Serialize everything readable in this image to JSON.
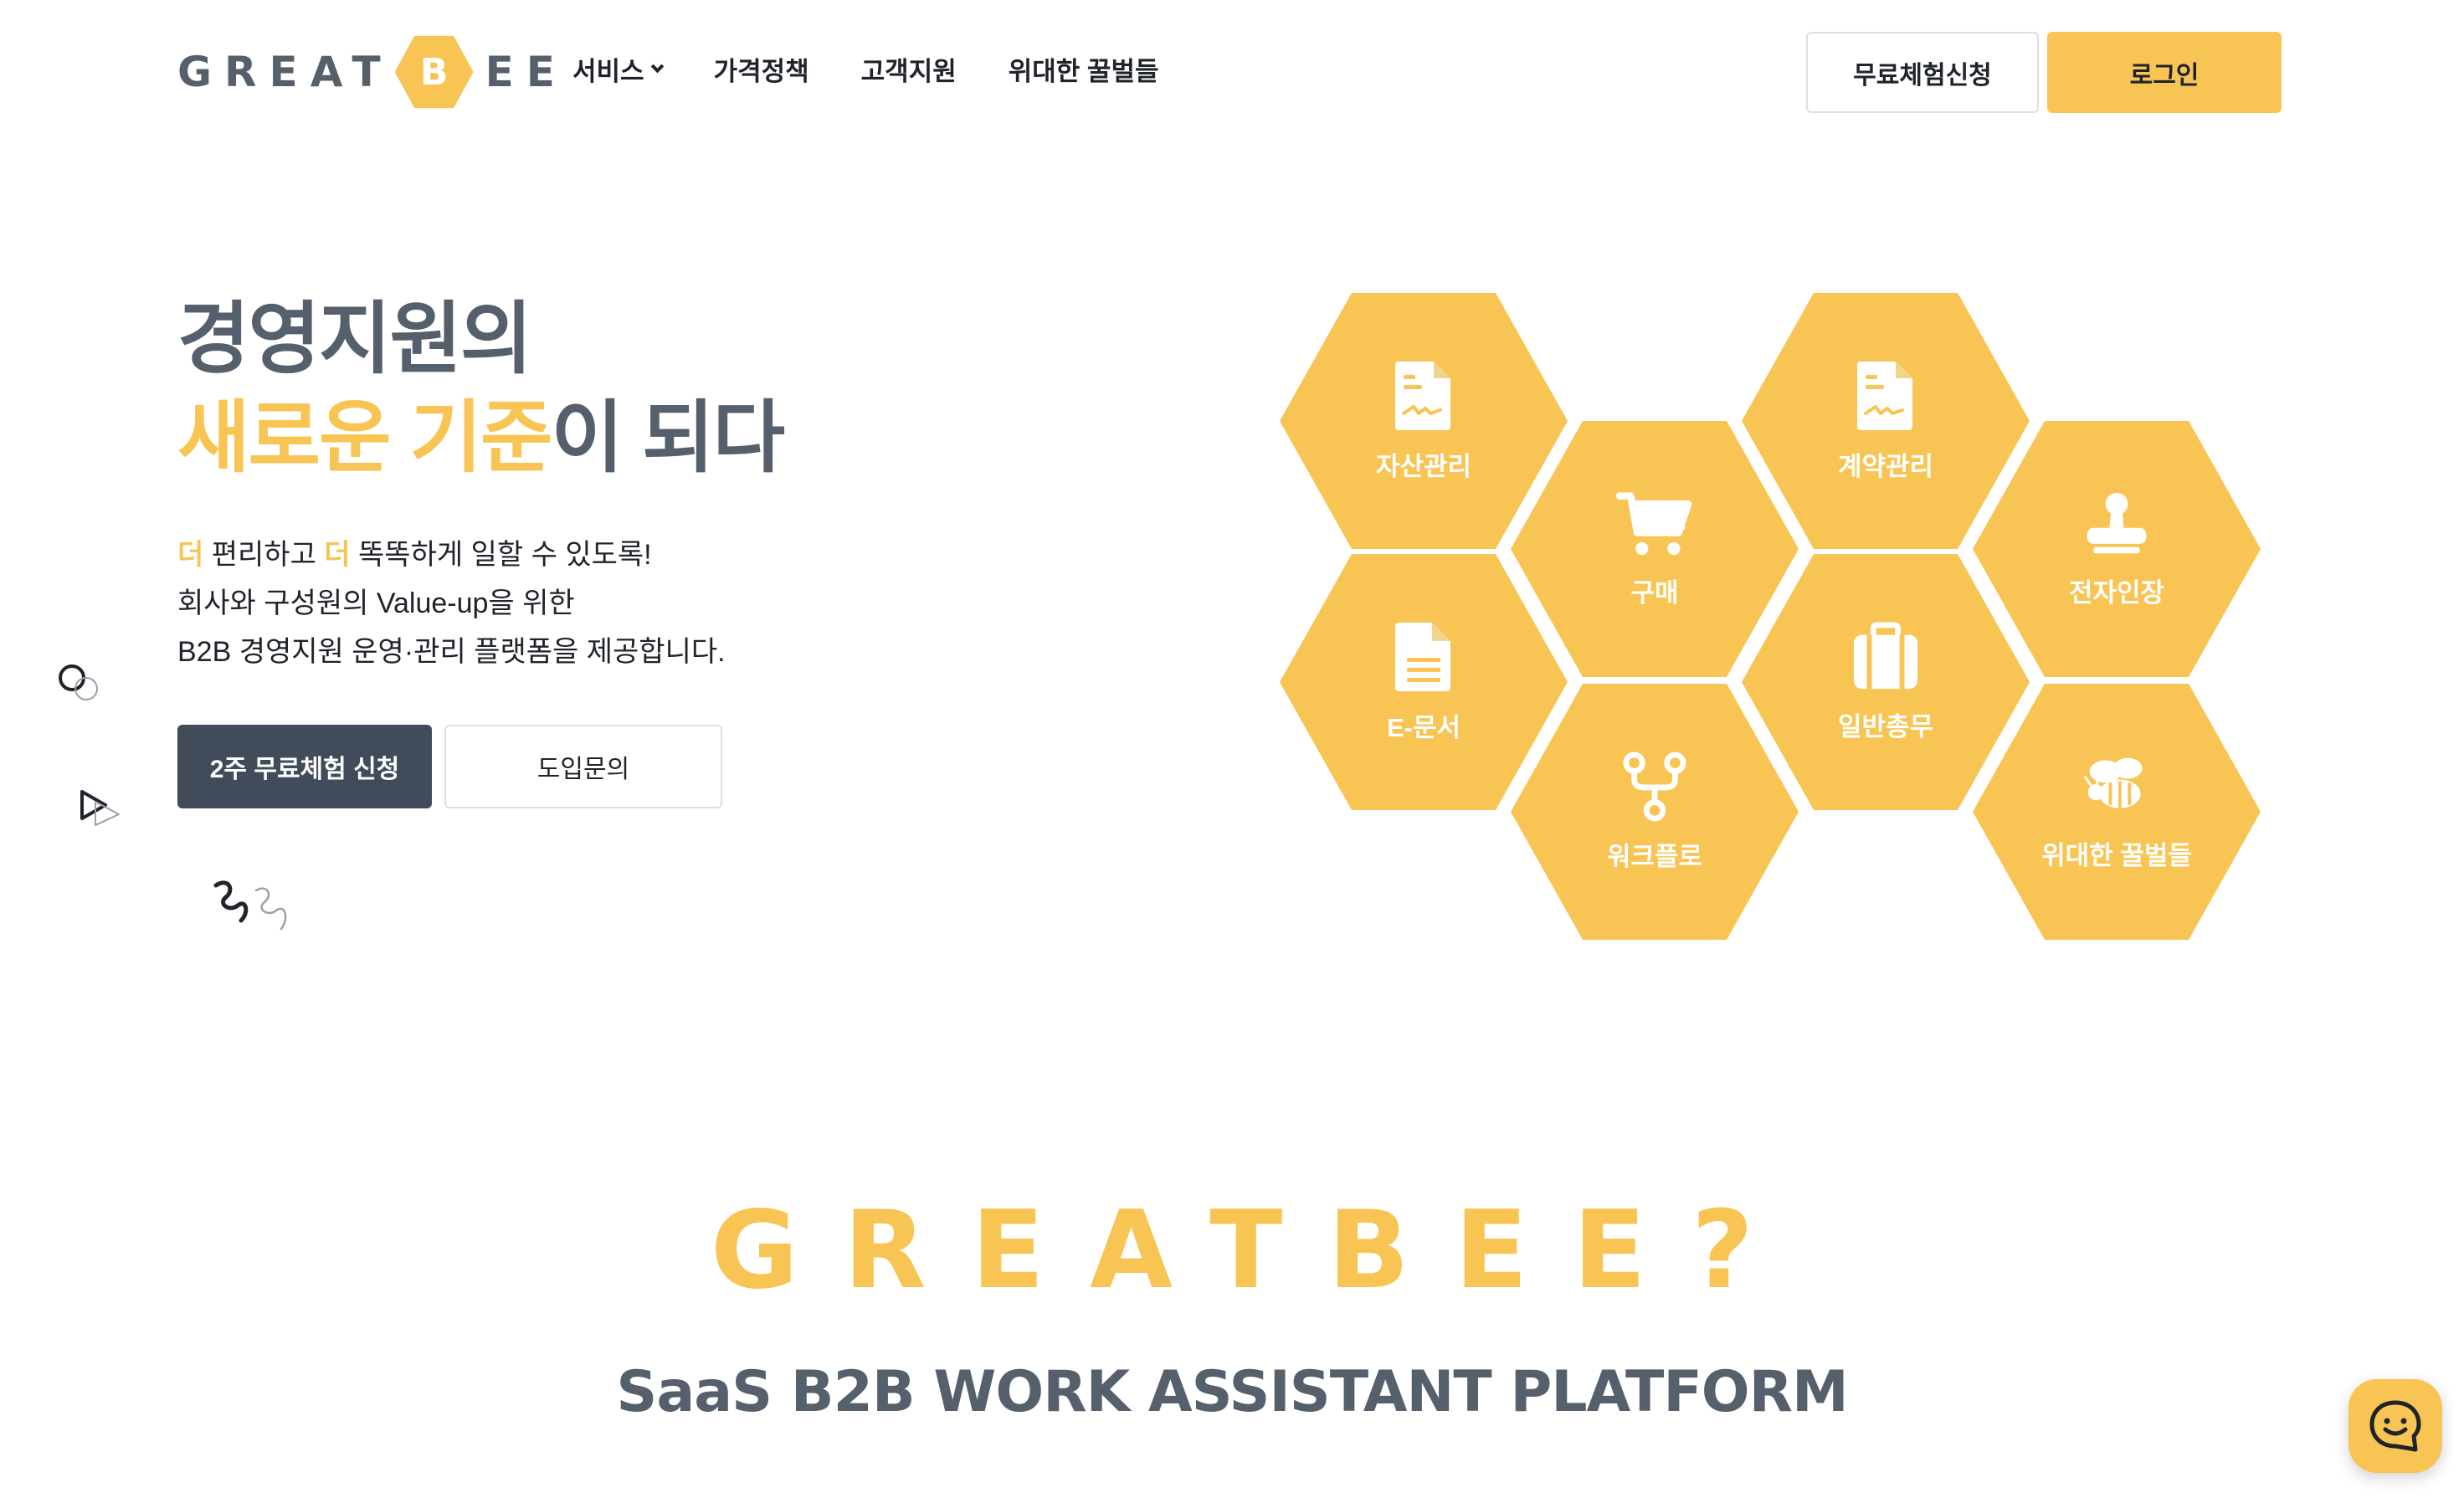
{
  "brand": {
    "logo_left": "GREAT",
    "logo_mid": "B",
    "logo_right": "EE"
  },
  "nav": {
    "items": [
      {
        "label": "서비스",
        "has_dropdown": true
      },
      {
        "label": "가격정책"
      },
      {
        "label": "고객지원"
      },
      {
        "label": "위대한 꿀벌들"
      }
    ],
    "trial_button": "무료체험신청",
    "login_button": "로그인"
  },
  "hero": {
    "title_line1": "경영지원의",
    "title_highlight": "새로운 기준",
    "title_rest": "이 되다",
    "desc_word1": "더",
    "desc_mid1": " 편리하고 ",
    "desc_word2": "더",
    "desc_mid2": " 똑똑하게 일할 수 있도록!",
    "desc_line2": "회사와 구성원의 Value-up을 위한",
    "desc_line3": "B2B 경영지원 운영·관리 플랫폼을 제공합니다.",
    "btn_trial": "2주 무료체험 신청",
    "btn_inquiry": "도입문의"
  },
  "services": [
    {
      "label": "자산관리",
      "icon": "document-icon"
    },
    {
      "label": "구매",
      "icon": "cart-icon"
    },
    {
      "label": "계약관리",
      "icon": "document-icon"
    },
    {
      "label": "전자인장",
      "icon": "stamp-icon"
    },
    {
      "label": "E-문서",
      "icon": "file-text-icon"
    },
    {
      "label": "일반총무",
      "icon": "briefcase-icon"
    },
    {
      "label": "워크플로",
      "icon": "workflow-icon"
    },
    {
      "label": "위대한 꿀벌들",
      "icon": "bee-icon"
    }
  ],
  "about": {
    "title": "GREATBEE?",
    "subtitle": "SaaS B2B WORK ASSISTANT PLATFORM"
  },
  "colors": {
    "accent": "#f8c453",
    "slate": "#55606c",
    "dark_button": "#414b5a"
  }
}
